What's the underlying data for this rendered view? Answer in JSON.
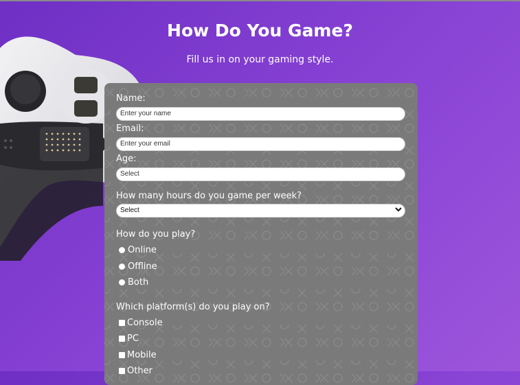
{
  "header": {
    "title": "How Do You Game?",
    "subtitle": "Fill us in on your gaming style."
  },
  "form": {
    "name_label": "Name:",
    "name_placeholder": "Enter your name",
    "email_label": "Email:",
    "email_placeholder": "Enter your email",
    "age_label": "Age:",
    "age_placeholder": "Select",
    "hours_label": "How many hours do you game per week?",
    "hours_value": "Select",
    "play_label": "How do you play?",
    "play_options": [
      "Online",
      "Offline",
      "Both"
    ],
    "platform_label": "Which platform(s) do you play on?",
    "platform_options": [
      "Console",
      "PC",
      "Mobile",
      "Other"
    ]
  },
  "colors": {
    "background_start": "#6f2fc4",
    "background_end": "#9c55da",
    "form_background": "#7a7a7a"
  },
  "icons": [
    "gamepad-image",
    "chevron-down-icon",
    "pattern-x-icon",
    "pattern-o-icon"
  ]
}
